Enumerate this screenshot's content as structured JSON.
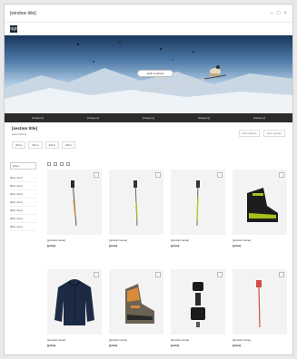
{
  "window": {
    "title": "[window title]",
    "controls": [
      "–",
      "□",
      "×"
    ]
  },
  "logo_text": "[logo]",
  "hero": {
    "cta_label": "[call to action]"
  },
  "category_nav": [
    "[category]",
    "[category]",
    "[category]",
    "[category]",
    "[category]"
  ],
  "info": {
    "title": "[section title]",
    "description": "[description]",
    "crumbs": [
      "[filter]",
      "[filter]",
      "[filter]",
      "[filter]"
    ],
    "sort": [
      "[sort option]",
      "[sort option]"
    ]
  },
  "filters": {
    "box_label": "[filter]",
    "items": [
      "[filter item]",
      "[filter item]",
      "[filter item]",
      "[filter item]",
      "[filter item]",
      "[filter item]",
      "[filter item]"
    ]
  },
  "products": [
    {
      "name": "[product name]",
      "price": "[price]",
      "icon": "ski-pole-icon"
    },
    {
      "name": "[product name]",
      "price": "[price]",
      "icon": "ski-pole-icon"
    },
    {
      "name": "[product name]",
      "price": "[price]",
      "icon": "ski-pole-icon"
    },
    {
      "name": "[product name]",
      "price": "[price]",
      "icon": "ski-boot-icon"
    },
    {
      "name": "[product name]",
      "price": "[price]",
      "icon": "hoodie-icon"
    },
    {
      "name": "[product name]",
      "price": "[price]",
      "icon": "ski-boot-icon"
    },
    {
      "name": "[product name]",
      "price": "[price]",
      "icon": "binding-icon"
    },
    {
      "name": "[product name]",
      "price": "[price]",
      "icon": "ski-pole-icon"
    }
  ],
  "colors": {
    "nav_bg": "#2b2b2b",
    "hero_sky": "#4d79a8",
    "accent_green": "#9ec01e",
    "accent_red": "#d44c4c"
  }
}
